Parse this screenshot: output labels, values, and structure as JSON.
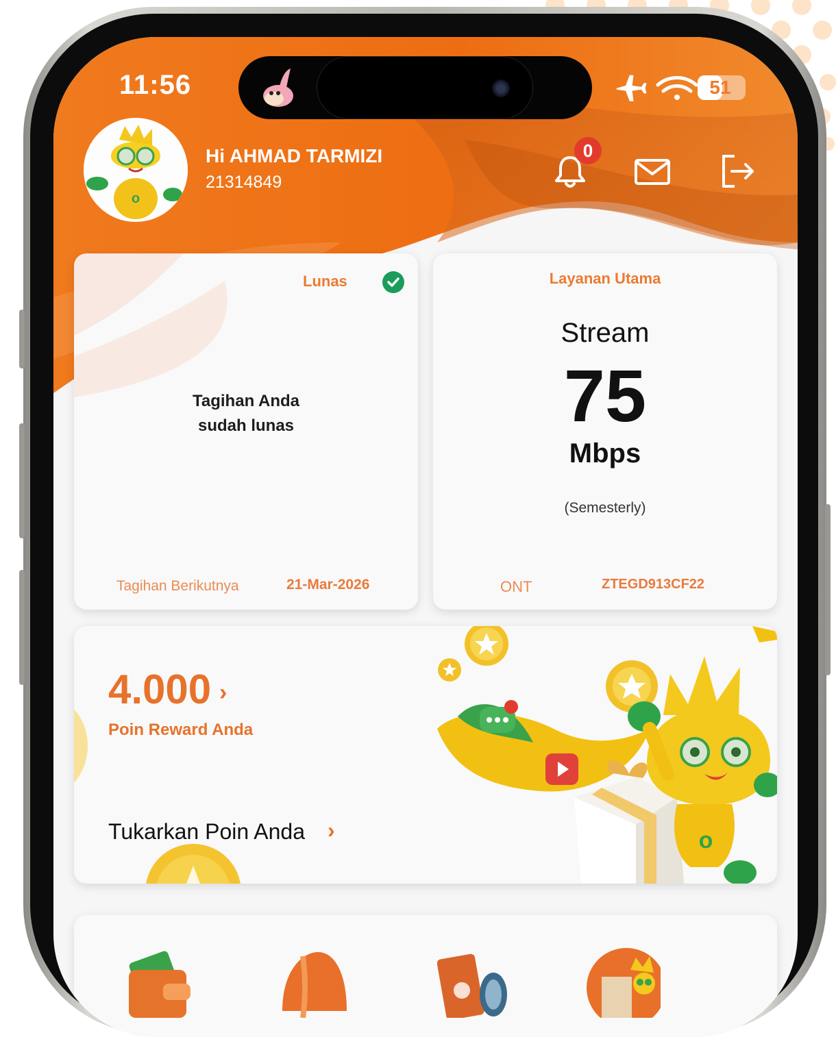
{
  "status_bar": {
    "time": "11:56",
    "battery": "51",
    "battery_level": 0.51,
    "icons": [
      "airplane-icon",
      "wifi-icon",
      "battery-icon"
    ]
  },
  "header": {
    "greeting": "Hi AHMAD TARMIZI",
    "customer_id": "21314849",
    "notification_count": "0",
    "icons": [
      "bell-icon",
      "mail-icon",
      "logout-icon"
    ]
  },
  "billing": {
    "status": "Lunas",
    "message_line1": "Tagihan Anda",
    "message_line2": "sudah lunas",
    "next_label": "Tagihan Berikutnya",
    "next_date": "21-Mar-2026"
  },
  "service": {
    "title": "Layanan Utama",
    "name": "Stream",
    "speed": "75",
    "unit": "Mbps",
    "period": "(Semesterly)",
    "ont_label": "ONT",
    "ont_value": "ZTEGD913CF22"
  },
  "reward": {
    "points": "4.000",
    "chevron": "›",
    "label": "Poin Reward Anda",
    "redeem_label": "Tukarkan Poin Anda",
    "redeem_chevron": "›"
  },
  "menu": {
    "items": [
      "wallet-icon",
      "helmet-icon",
      "manual-icon",
      "mascot-icon"
    ]
  },
  "colors": {
    "brand_orange": "#ee7623",
    "accent_text": "#e7722b",
    "success_green": "#1a9c5a",
    "badge_red": "#e33b2b"
  }
}
